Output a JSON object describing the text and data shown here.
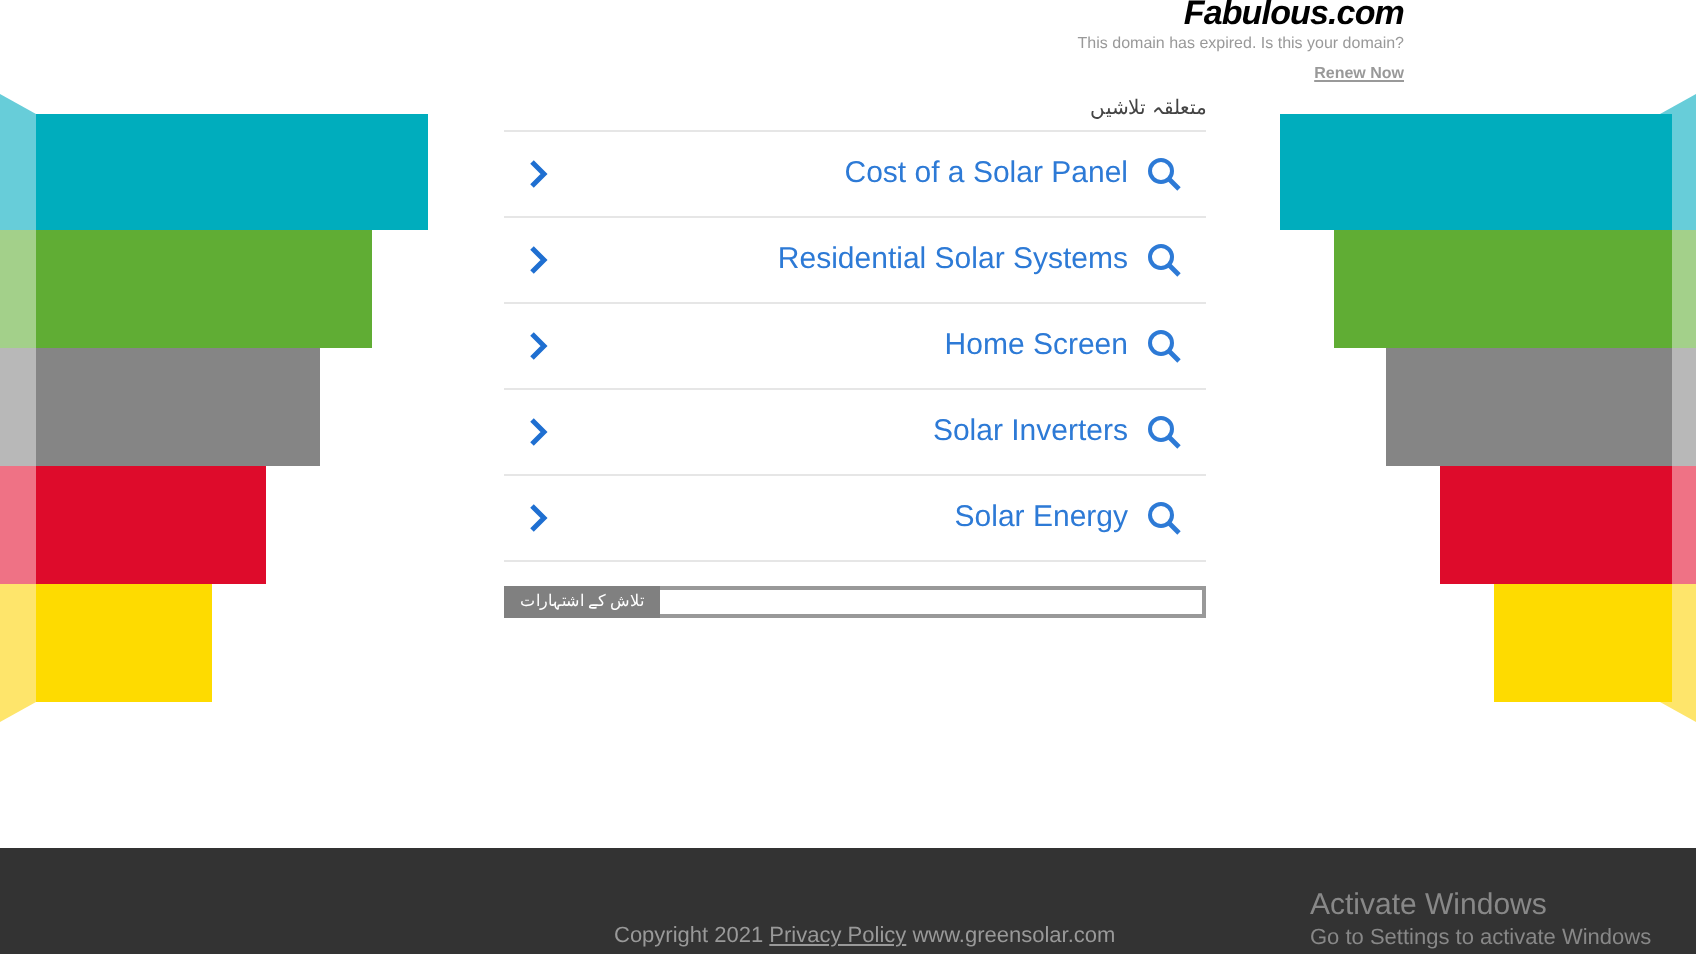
{
  "header": {
    "logo": "Fabulous.com",
    "notice": "This domain has expired. Is this your domain?",
    "renew_link": "Renew Now"
  },
  "related": {
    "heading": "متعلقہ تلاشیں",
    "links": [
      {
        "label": "Cost of a Solar Panel"
      },
      {
        "label": "Residential Solar Systems"
      },
      {
        "label": "Home Screen"
      },
      {
        "label": "Solar Inverters"
      },
      {
        "label": "Solar Energy"
      }
    ]
  },
  "ad_search": {
    "label": "تلاش کے اشتہارات"
  },
  "footer": {
    "copyright": "Copyright 2021",
    "privacy_link": "Privacy Policy",
    "domain": "www.greensolar.com"
  },
  "activation": {
    "title": "Activate Windows",
    "message": "Go to Settings to activate Windows"
  }
}
